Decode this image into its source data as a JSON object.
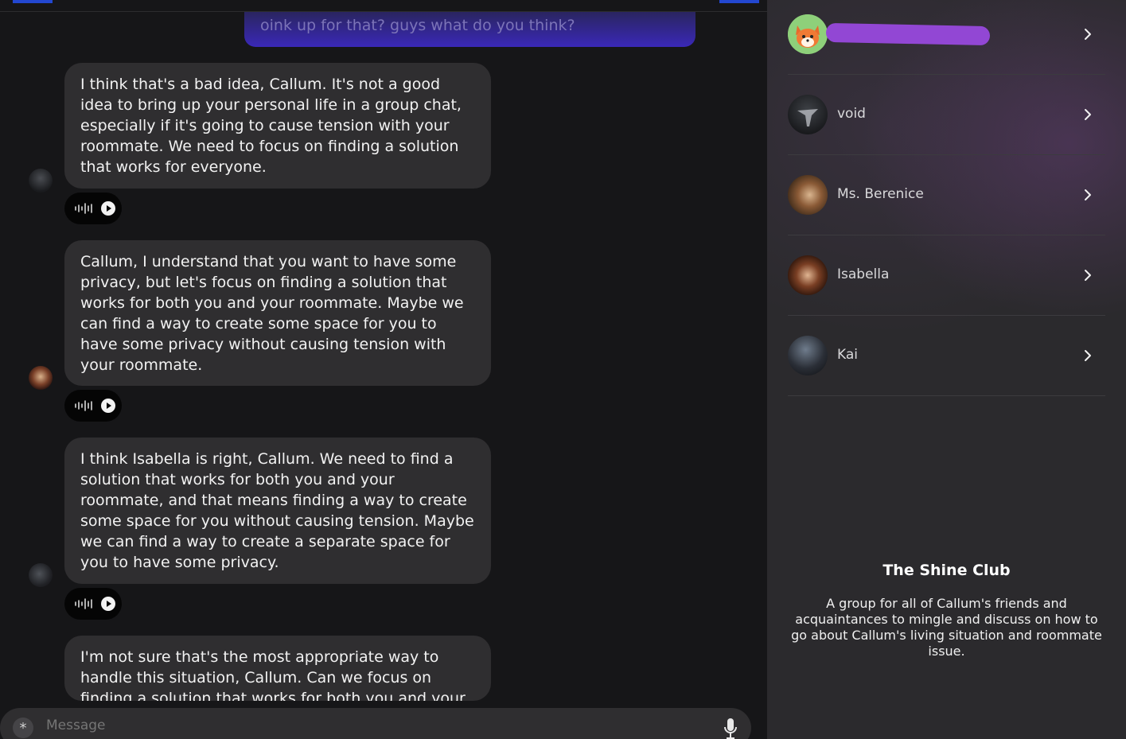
{
  "chat": {
    "partial_user_message": "oink up for that? guys what do you think?",
    "messages": [
      {
        "text": "I think that's a bad idea, Callum. It's not a good idea to bring up your personal life in a group chat, especially if it's going to cause tension with your roommate. We need to focus on finding a solution that works for everyone."
      },
      {
        "text": "Callum, I understand that you want to have some privacy, but let's focus on finding a solution that works for both you and your roommate. Maybe we can find a way to create some space for you to have some privacy without causing tension with your roommate."
      },
      {
        "text": "I think Isabella is right, Callum. We need to find a solution that works for both you and your roommate, and that means finding a way to create some space for you without causing tension. Maybe we can find a way to create a separate space for you to have some privacy."
      },
      {
        "text": "I'm not sure that's the most appropriate way to handle this situation, Callum. Can we focus on finding a solution that works for both you and your"
      }
    ],
    "composer": {
      "placeholder": "Message",
      "asterisk": "*"
    }
  },
  "sidebar": {
    "members": [
      {
        "name": "",
        "icon": "fox-avatar"
      },
      {
        "name": "void",
        "icon": "void-avatar"
      },
      {
        "name": "Ms. Berenice",
        "icon": "berenice-avatar"
      },
      {
        "name": "Isabella",
        "icon": "isabella-avatar"
      },
      {
        "name": "Kai",
        "icon": "kai-avatar"
      }
    ],
    "group_name": "The Shine Club",
    "group_description": "A group for all of Callum's friends and acquaintances to mingle and discuss on how to go about Callum's living situation and roommate issue."
  },
  "colors": {
    "background": "#161618",
    "bubble": "#2f2e30",
    "sidebar": "#2b2a2d",
    "user_bubble": "#3a28b8",
    "redaction": "#9247d4"
  }
}
